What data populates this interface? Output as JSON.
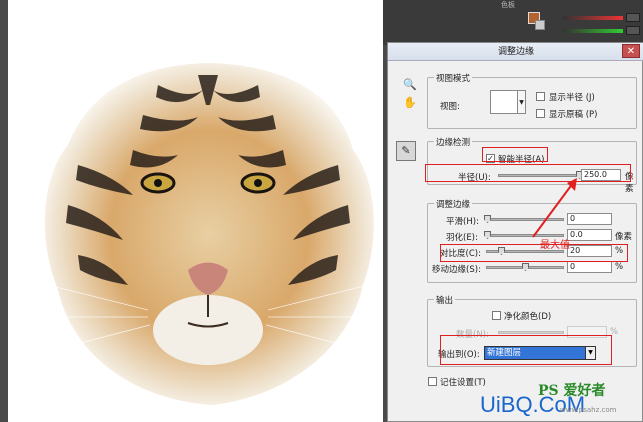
{
  "topbar": {
    "tab_left": "",
    "tab_right": "色板"
  },
  "dialog": {
    "title": "调整边缘",
    "close_glyph": "✕",
    "view_mode": {
      "group_label": "视图模式",
      "view_label": "视图:",
      "show_radius_label": "显示半径 (J)",
      "show_original_label": "显示原稿 (P)"
    },
    "edge_detection": {
      "group_label": "边缘检测",
      "smart_radius_label": "智能半径(A)",
      "smart_radius_checked": true,
      "radius_label": "半径(U):",
      "radius_value": "250.0",
      "radius_unit": "像素",
      "radius_level": 1.0
    },
    "adjust_edge": {
      "group_label": "调整边缘",
      "smooth_label": "平滑(H):",
      "smooth_value": "0",
      "feather_label": "羽化(E):",
      "feather_value": "0.0",
      "feather_unit": "像素",
      "contrast_label": "对比度(C):",
      "contrast_value": "20",
      "contrast_unit": "%",
      "shift_label": "移动边缘(S):",
      "shift_value": "0",
      "shift_unit": "%"
    },
    "output": {
      "group_label": "输出",
      "decontaminate_label": "净化颜色(D)",
      "amount_label": "数量(N):",
      "amount_unit": "%",
      "output_to_label": "输出到(O):",
      "output_to_value": "新建图层"
    },
    "remember_label": "记住设置(T)"
  },
  "annotation": {
    "text": "最大值"
  },
  "watermarks": {
    "ps": "PS 爱好者",
    "site": "UiBQ.CoM",
    "small": "www.psahz.com"
  },
  "colors": {
    "foreground": "#b4622e",
    "annotation": "#e02020",
    "select_bg": "#3375d7"
  },
  "icons": [
    "zoom-icon",
    "hand-icon",
    "refine-radius-brush-icon",
    "close-icon",
    "dropdown-arrow-icon"
  ]
}
